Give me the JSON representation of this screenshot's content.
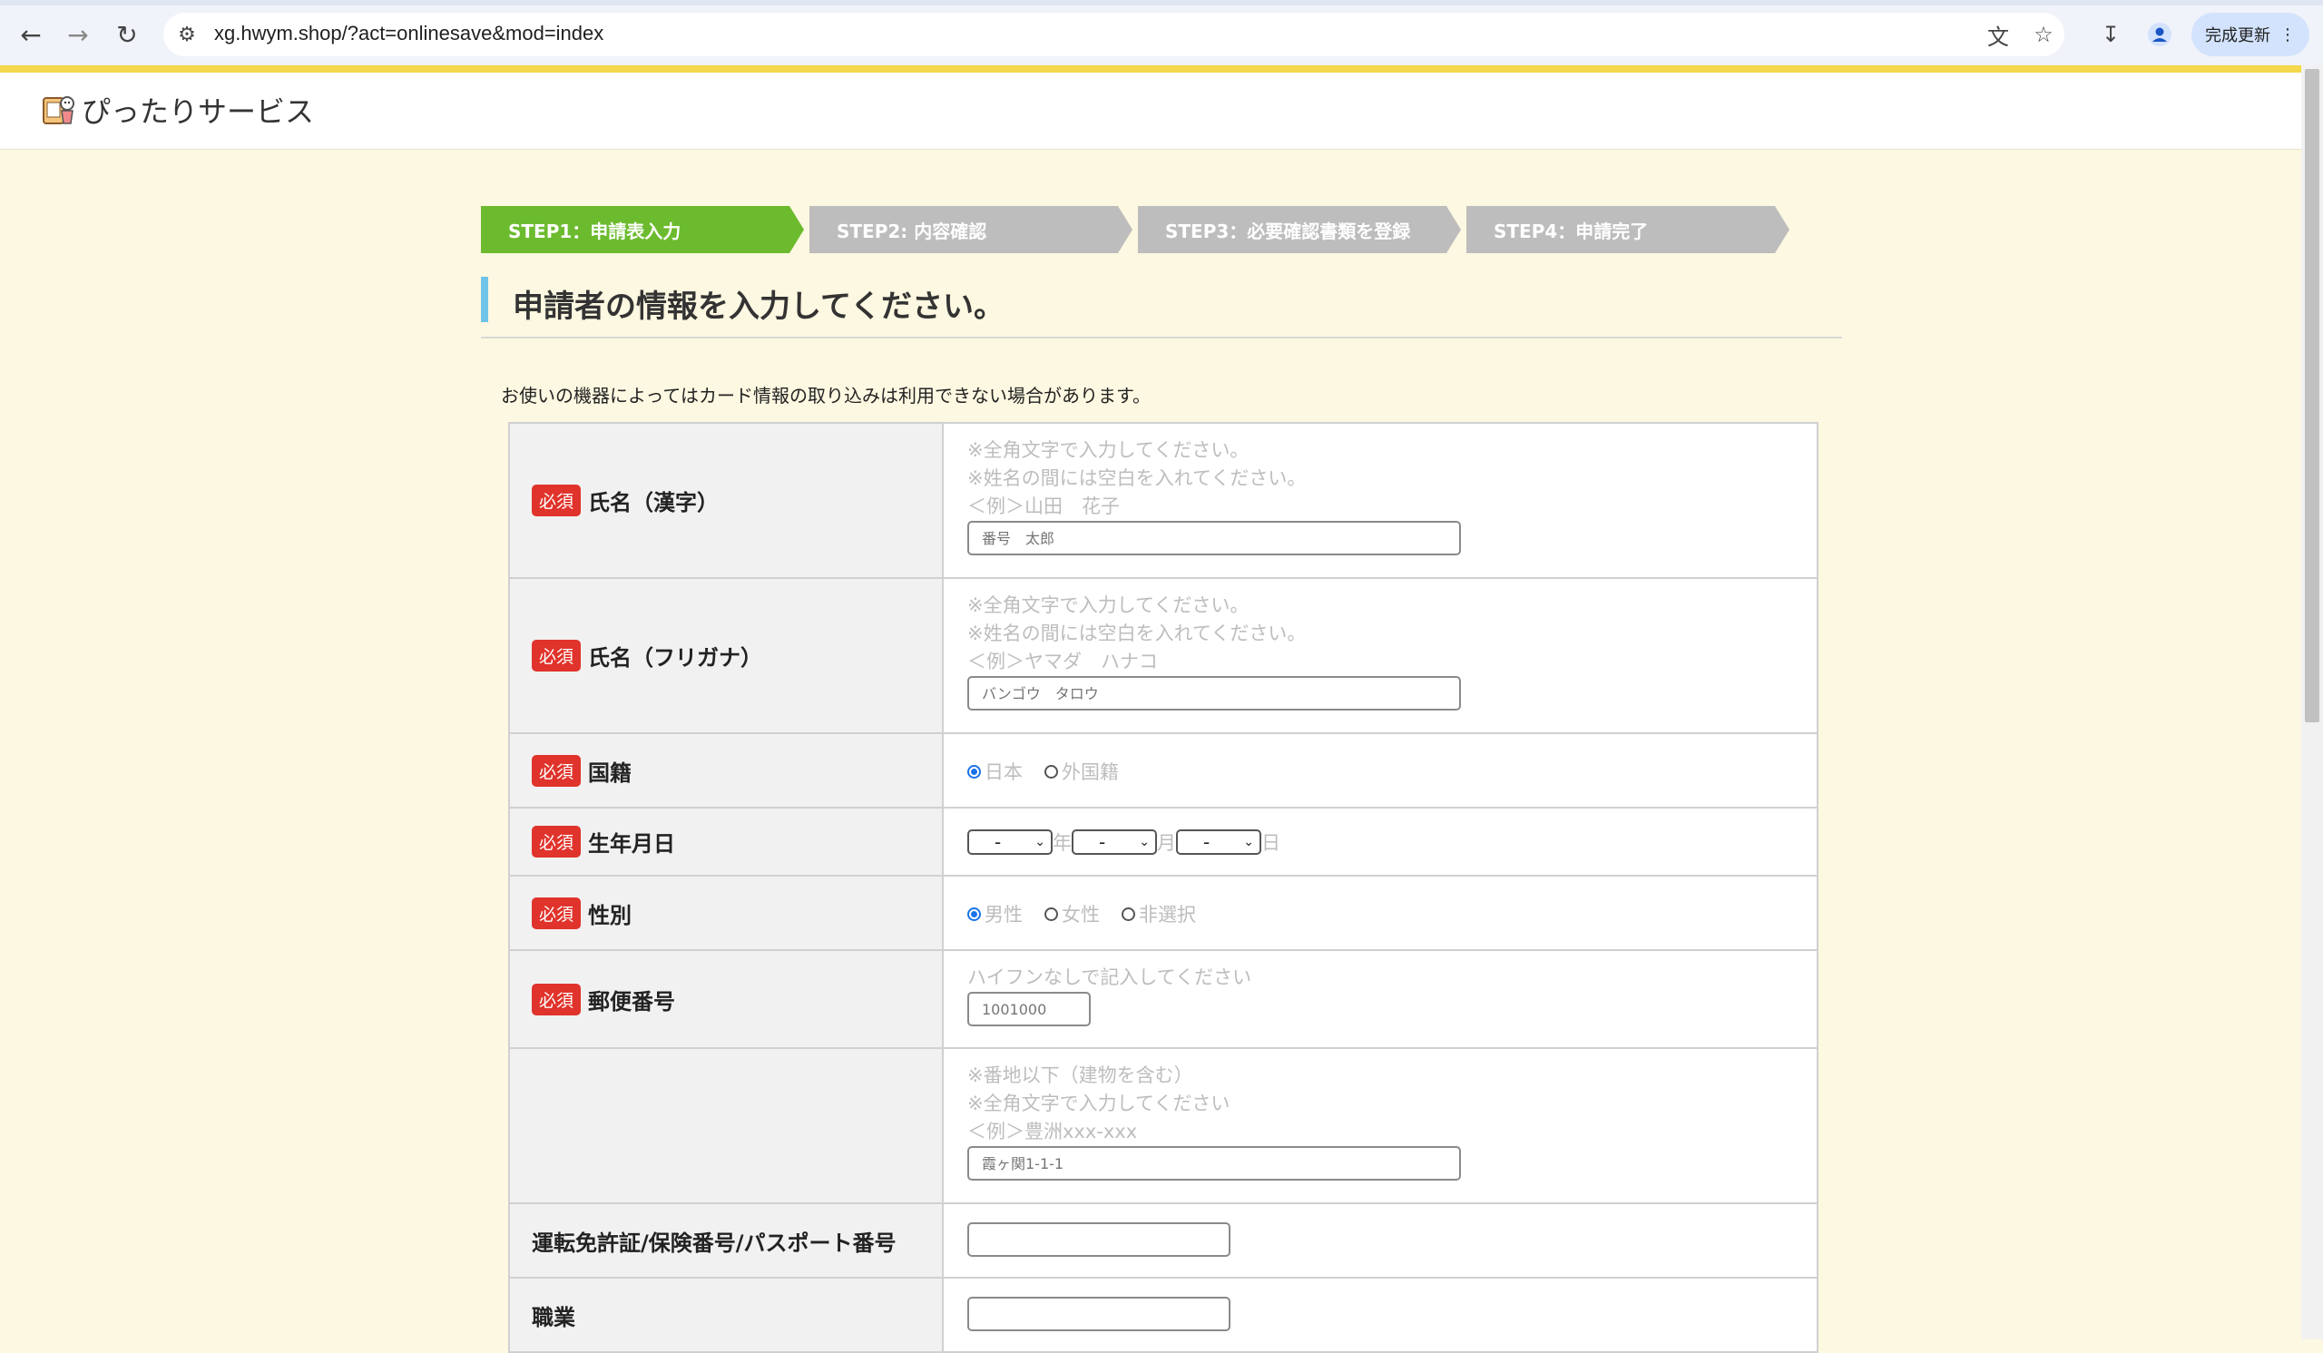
{
  "browser": {
    "url": "xg.hwym.shop/?act=onlinesave&mod=index",
    "update_label": "完成更新",
    "icons": [
      "back-icon",
      "forward-icon",
      "reload-icon",
      "site-settings-icon",
      "translate-icon",
      "star-icon",
      "download-icon",
      "profile-icon",
      "more-icon"
    ]
  },
  "site": {
    "name": "ぴったりサービス"
  },
  "steps": [
    {
      "label": "STEP1：申請表入力",
      "active": true
    },
    {
      "label": "STEP2: 内容確認",
      "active": false
    },
    {
      "label": "STEP3：必要確認書類を登録",
      "active": false
    },
    {
      "label": "STEP4：申請完了",
      "active": false
    }
  ],
  "colors": {
    "step_active": "#6cbb2f",
    "step_inactive": "#bdbdbd",
    "required": "#e0332b",
    "accent_bar": "#6ec5e8",
    "top_bar": "#f2d84a"
  },
  "section_title": "申請者の情報を入力してください。",
  "notice": "お使いの機器によってはカード情報の取り込みは利用できない場合があります。",
  "required_label": "必須",
  "form": {
    "name_kanji": {
      "label": "氏名（漢字）",
      "hints": [
        "※全角文字で入力してください。",
        "※姓名の間には空白を入れてください。",
        "＜例＞山田　花子"
      ],
      "placeholder": "番号　太郎"
    },
    "name_kana": {
      "label": "氏名（フリガナ）",
      "hints": [
        "※全角文字で入力してください。",
        "※姓名の間には空白を入れてください。",
        "＜例＞ヤマダ　ハナコ"
      ],
      "placeholder": "バンゴウ　タロウ"
    },
    "nationality": {
      "label": "国籍",
      "options": [
        "日本",
        "外国籍"
      ],
      "selected": "日本"
    },
    "dob": {
      "label": "生年月日",
      "year_value": "-",
      "month_value": "-",
      "day_value": "-",
      "year_unit": "年",
      "month_unit": "月",
      "day_unit": "日"
    },
    "gender": {
      "label": "性別",
      "options": [
        "男性",
        "女性",
        "非選択"
      ],
      "selected": "男性"
    },
    "postal": {
      "label": "郵便番号",
      "hint": "ハイフンなしで記入してください",
      "placeholder": "1001000"
    },
    "address": {
      "hints": [
        "※番地以下（建物を含む）",
        "※全角文字で入力してください",
        "＜例＞豊洲xxx-xxx"
      ],
      "placeholder": "霞ヶ関1-1-1"
    },
    "license": {
      "label": "運転免許証/保険番号/パスポート番号",
      "value": ""
    },
    "occupation": {
      "label": "職業",
      "value": ""
    }
  }
}
